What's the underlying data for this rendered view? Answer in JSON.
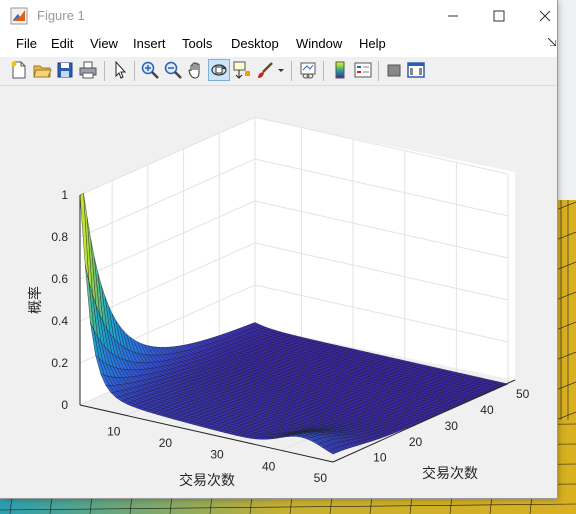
{
  "window": {
    "title": "Figure 1"
  },
  "menus": [
    "File",
    "Edit",
    "View",
    "Insert",
    "Tools",
    "Desktop",
    "Window",
    "Help"
  ],
  "toolbar_icons": [
    "new-figure-icon",
    "open-file-icon",
    "save-icon",
    "print-icon",
    "pointer-icon",
    "zoom-in-icon",
    "zoom-out-icon",
    "pan-icon",
    "rotate-3d-icon",
    "data-cursor-icon",
    "brush-icon",
    "brush-dropdown-icon",
    "link-plot-icon",
    "colorbar-icon",
    "legend-icon",
    "hide-plot-tools-icon",
    "show-plot-tools-icon"
  ],
  "chart_data": {
    "type": "surface",
    "zlabel": "概率",
    "xlabel": "交易次数",
    "ylabel": "交易次数",
    "zlim": [
      0,
      1
    ],
    "xlim": [
      1,
      50
    ],
    "ylim": [
      1,
      50
    ],
    "z_ticks": [
      "0",
      "0.2",
      "0.4",
      "0.6",
      "0.8",
      "1"
    ],
    "x_ticks": [
      "10",
      "20",
      "30",
      "40",
      "50"
    ],
    "y_ticks": [
      "10",
      "20",
      "30",
      "40",
      "50"
    ],
    "grid": true,
    "colormap": "parula",
    "colors": {
      "low": "#3e26a8",
      "mid": "#2a9fd8",
      "high": "#f9fb0e"
    },
    "peak": {
      "x": 1,
      "y": 1,
      "z": 1.0
    }
  }
}
